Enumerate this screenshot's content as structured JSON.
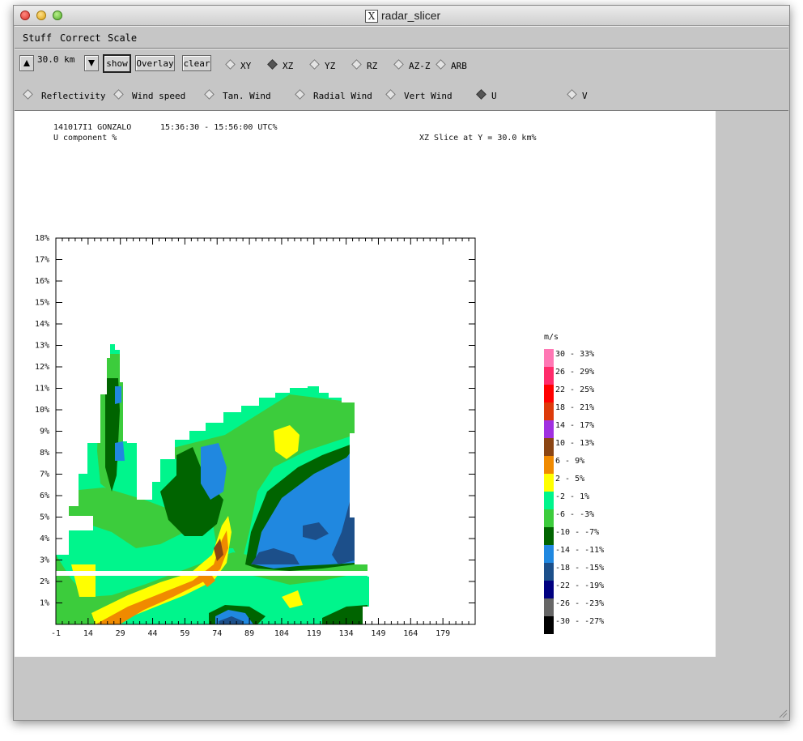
{
  "window": {
    "title": "radar_slicer"
  },
  "menu": [
    "Stuff",
    "Correct",
    "Scale"
  ],
  "toolbar": {
    "range_value": "30.0 km",
    "buttons": {
      "show": "show",
      "overlay": "Overlay",
      "clear": "clear"
    },
    "views": [
      "XY",
      "XZ",
      "YZ",
      "RZ",
      "AZ-Z",
      "ARB"
    ],
    "selected_view": "XZ",
    "fields": [
      "Reflectivity",
      "Wind speed",
      "Tan. Wind",
      "Radial Wind",
      "Vert Wind",
      "U",
      "V"
    ],
    "selected_field": "U"
  },
  "plot_header": {
    "case": "141017I1 GONZALO",
    "time": "15:36:30 - 15:56:00 UTC%",
    "component": "U component %",
    "slice": "XZ Slice at Y = 30.0 km%"
  },
  "chart_data": {
    "type": "heatmap",
    "x_ticks": [
      "-1",
      "14",
      "29",
      "44",
      "59",
      "74",
      "89",
      "104",
      "119",
      "134",
      "149",
      "164",
      "179"
    ],
    "y_ticks": [
      "1%",
      "2%",
      "3%",
      "4%",
      "5%",
      "6%",
      "7%",
      "8%",
      "9%",
      "10%",
      "11%",
      "12%",
      "13%",
      "14%",
      "15%",
      "16%",
      "17%",
      "18%"
    ],
    "xlim": [
      -1,
      194
    ],
    "ylim": [
      0,
      18
    ],
    "legend_unit": "m/s",
    "legend": [
      {
        "label": "30 - 33%",
        "color": "#ff77b4"
      },
      {
        "label": "26 - 29%",
        "color": "#ff2b6a"
      },
      {
        "label": "22 - 25%",
        "color": "#ff0000"
      },
      {
        "label": "18 - 21%",
        "color": "#dd3a0a"
      },
      {
        "label": "14 - 17%",
        "color": "#a030e0"
      },
      {
        "label": "10 - 13%",
        "color": "#8b4513"
      },
      {
        "label": "6 - 9%",
        "color": "#f08a00"
      },
      {
        "label": "2 - 5%",
        "color": "#ffff00"
      },
      {
        "label": "-2 - 1%",
        "color": "#00f58c"
      },
      {
        "label": "-6 - -3%",
        "color": "#3ccc3c"
      },
      {
        "label": "-10 - -7%",
        "color": "#006400"
      },
      {
        "label": "-14 - -11%",
        "color": "#2088e0"
      },
      {
        "label": "-18 - -15%",
        "color": "#1c4f8a"
      },
      {
        "label": "-22 - -19%",
        "color": "#000080"
      },
      {
        "label": "-26 - -23%",
        "color": "#666666"
      },
      {
        "label": "-30 - -27%",
        "color": "#000000"
      }
    ]
  }
}
